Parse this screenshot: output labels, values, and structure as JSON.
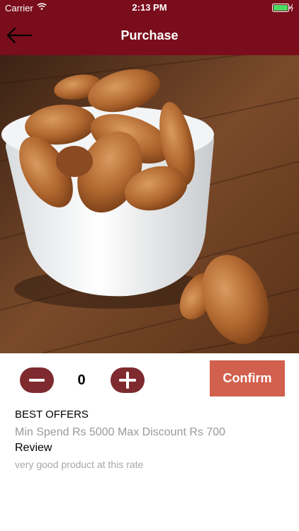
{
  "status_bar": {
    "carrier": "Carrier",
    "time": "2:13 PM",
    "icons": [
      "wifi-icon",
      "battery-icon",
      "charging-icon"
    ]
  },
  "nav": {
    "title": "Purchase",
    "back_icon": "back-arrow-icon"
  },
  "hero": {
    "image": "almonds-in-white-bowl"
  },
  "quantity": {
    "value": "0",
    "minus_icon": "minus-icon",
    "plus_icon": "plus-icon"
  },
  "confirm_label": "Confirm",
  "offers": {
    "title": "BEST OFFERS",
    "text": "Min Spend Rs 5000 Max Discount Rs 700"
  },
  "review": {
    "title": "Review",
    "text": "very good product at this rate"
  },
  "colors": {
    "header": "#7a0d1b",
    "stepper": "#7e2a2e",
    "confirm": "#d1604e",
    "battery": "#4cd964"
  }
}
